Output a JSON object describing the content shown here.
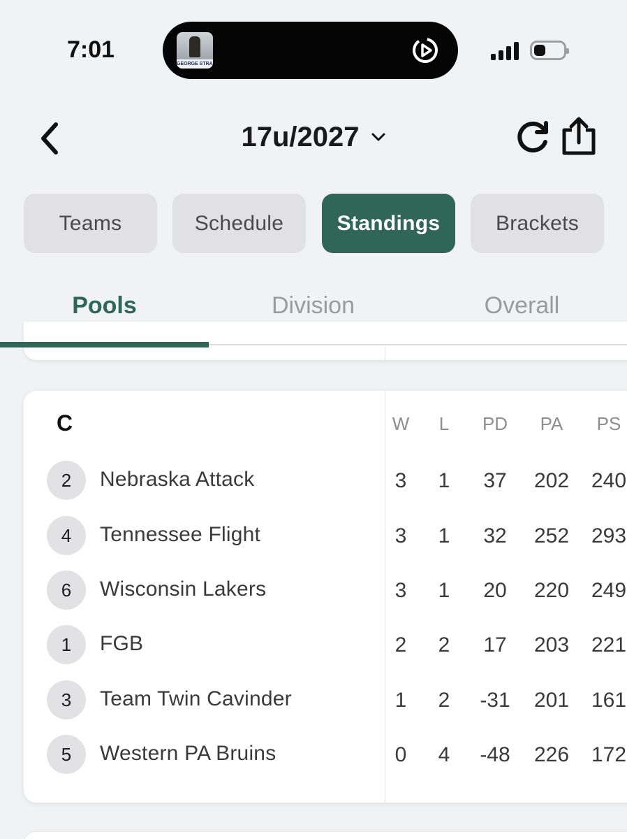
{
  "status_bar": {
    "time": "7:01",
    "now_playing_art_label": "GEORGE STRAIT"
  },
  "header": {
    "title": "17u/2027"
  },
  "tabs": [
    {
      "label": "Teams",
      "active": false
    },
    {
      "label": "Schedule",
      "active": false
    },
    {
      "label": "Standings",
      "active": true
    },
    {
      "label": "Brackets",
      "active": false
    }
  ],
  "subtabs": [
    {
      "label": "Pools",
      "active": true
    },
    {
      "label": "Division",
      "active": false
    },
    {
      "label": "Overall",
      "active": false
    }
  ],
  "pool": {
    "name": "C",
    "columns": [
      "W",
      "L",
      "PD",
      "PA",
      "PS"
    ],
    "rows": [
      {
        "seed": "2",
        "team": "Nebraska Attack",
        "w": "3",
        "l": "1",
        "pd": "37",
        "pa": "202",
        "ps": "240"
      },
      {
        "seed": "4",
        "team": "Tennessee Flight",
        "w": "3",
        "l": "1",
        "pd": "32",
        "pa": "252",
        "ps": "293"
      },
      {
        "seed": "6",
        "team": "Wisconsin Lakers",
        "w": "3",
        "l": "1",
        "pd": "20",
        "pa": "220",
        "ps": "249"
      },
      {
        "seed": "1",
        "team": "FGB",
        "w": "2",
        "l": "2",
        "pd": "17",
        "pa": "203",
        "ps": "221"
      },
      {
        "seed": "3",
        "team": "Team Twin Cavinder",
        "w": "1",
        "l": "2",
        "pd": "-31",
        "pa": "201",
        "ps": "161"
      },
      {
        "seed": "5",
        "team": "Western PA Bruins",
        "w": "0",
        "l": "4",
        "pd": "-48",
        "pa": "226",
        "ps": "172"
      }
    ]
  },
  "colors": {
    "accent": "#2f6656",
    "tab_inactive_bg": "#e1e1e3",
    "background": "#f1f2f4"
  },
  "icons": [
    "back-chevron-icon",
    "dropdown-chevron-icon",
    "refresh-icon",
    "share-icon",
    "play-icon",
    "signal-icon",
    "battery-icon"
  ]
}
